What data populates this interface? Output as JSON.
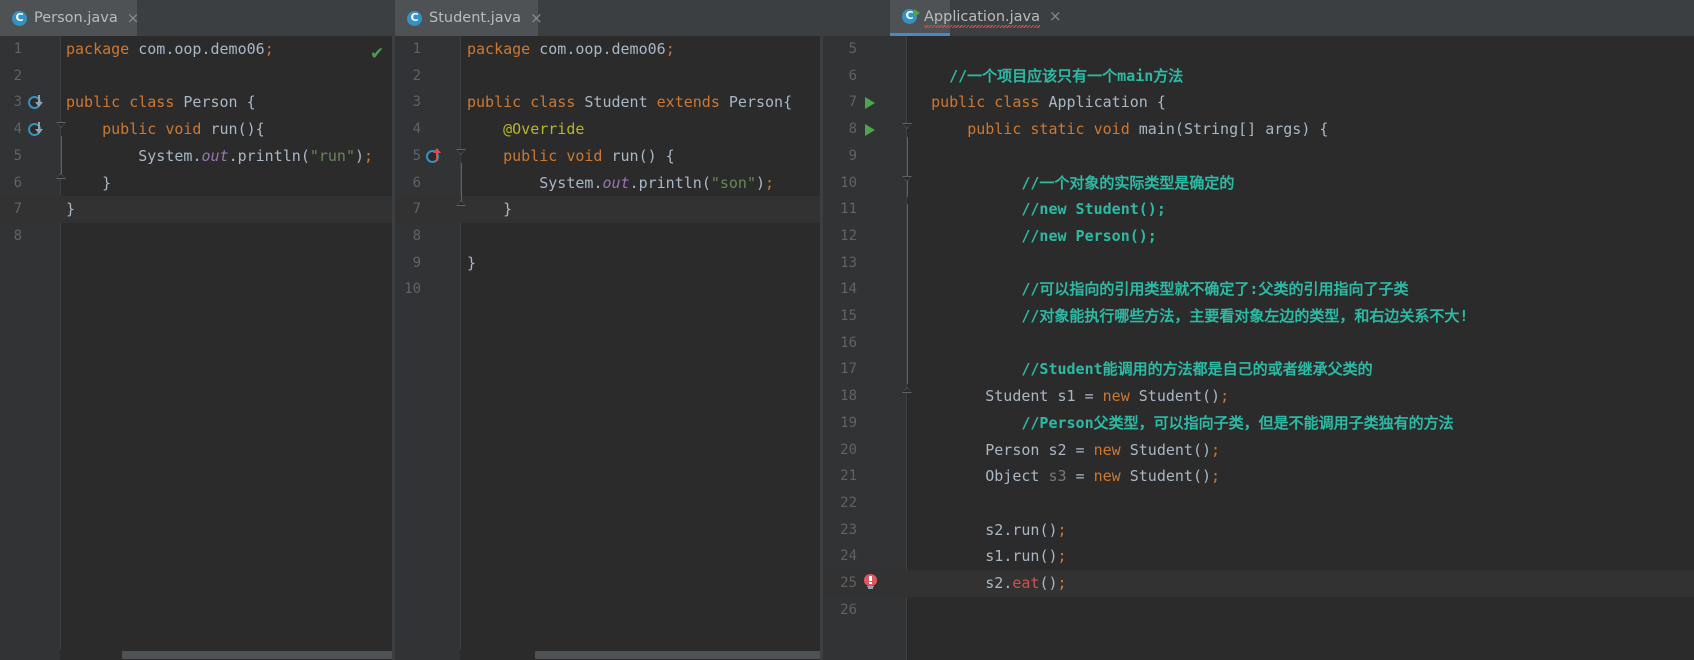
{
  "window": {
    "theme": "Darcula",
    "background": "#2b2b2b",
    "panel_background": "#3c3f41",
    "gutter_background": "#313335",
    "accent": "#4a88c7"
  },
  "tabs": [
    {
      "label": "Person.java",
      "icon": "java-class-icon",
      "close_glyph": "×",
      "state": "inactive",
      "runnable": false,
      "squiggly": false
    },
    {
      "label": "Student.java",
      "icon": "java-class-icon",
      "close_glyph": "×",
      "state": "inactive",
      "runnable": false,
      "squiggly": false
    },
    {
      "label": "Application.java",
      "icon": "java-class-runnable-icon",
      "close_glyph": "×",
      "state": "selected",
      "runnable": true,
      "squiggly": true
    }
  ],
  "panes": [
    {
      "name": "Person.java",
      "inspection_status": "ok",
      "inspection_glyph": "✔",
      "first_line": 1,
      "lines": [
        {
          "n": 1,
          "code": "package com.oop.demo06;"
        },
        {
          "n": 2,
          "code": ""
        },
        {
          "n": 3,
          "code": "public class Person {"
        },
        {
          "n": 4,
          "code": "    public void run(){"
        },
        {
          "n": 5,
          "code": "        System.out.println(\"run\");"
        },
        {
          "n": 6,
          "code": "    }"
        },
        {
          "n": 7,
          "code": "}"
        },
        {
          "n": 8,
          "code": ""
        }
      ],
      "caret_line": 7,
      "gutter_icons": [
        {
          "line": 3,
          "icon": "implemented-by-icon"
        },
        {
          "line": 4,
          "icon": "overridden-by-icon"
        }
      ]
    },
    {
      "name": "Student.java",
      "inspection_status": "ok",
      "inspection_glyph": "✔",
      "first_line": 1,
      "lines": [
        {
          "n": 1,
          "code": "package com.oop.demo06;"
        },
        {
          "n": 2,
          "code": ""
        },
        {
          "n": 3,
          "code": "public class Student extends Person{"
        },
        {
          "n": 4,
          "code": "    @Override"
        },
        {
          "n": 5,
          "code": "    public void run() {"
        },
        {
          "n": 6,
          "code": "        System.out.println(\"son\");"
        },
        {
          "n": 7,
          "code": "    }"
        },
        {
          "n": 8,
          "code": ""
        },
        {
          "n": 9,
          "code": "}"
        },
        {
          "n": 10,
          "code": ""
        }
      ],
      "caret_line": 7,
      "gutter_icons": [
        {
          "line": 5,
          "icon": "overrides-method-icon"
        }
      ]
    },
    {
      "name": "Application.java",
      "inspection_status": "error",
      "first_line": 5,
      "lines": [
        {
          "n": 5,
          "code": ""
        },
        {
          "n": 6,
          "code": "    //一个项目应该只有一个main方法"
        },
        {
          "n": 7,
          "code": "    public class Application {"
        },
        {
          "n": 8,
          "code": "        public static void main(String[] args) {"
        },
        {
          "n": 9,
          "code": ""
        },
        {
          "n": 10,
          "code": "            //一个对象的实际类型是确定的"
        },
        {
          "n": 11,
          "code": "            //new Student();"
        },
        {
          "n": 12,
          "code": "            //new Person();"
        },
        {
          "n": 13,
          "code": ""
        },
        {
          "n": 14,
          "code": "            //可以指向的引用类型就不确定了:父类的引用指向了子类"
        },
        {
          "n": 15,
          "code": "            //对象能执行哪些方法，主要看对象左边的类型，和右边关系不大!"
        },
        {
          "n": 16,
          "code": ""
        },
        {
          "n": 17,
          "code": "            //Student能调用的方法都是自己的或者继承父类的"
        },
        {
          "n": 18,
          "code": "            Student s1 = new Student();"
        },
        {
          "n": 19,
          "code": "            //Person父类型，可以指向子类，但是不能调用子类独有的方法"
        },
        {
          "n": 20,
          "code": "            Person s2 = new Student();"
        },
        {
          "n": 21,
          "code": "            Object s3 = new Student();"
        },
        {
          "n": 22,
          "code": ""
        },
        {
          "n": 23,
          "code": "            s2.run();"
        },
        {
          "n": 24,
          "code": "            s1.run();"
        },
        {
          "n": 25,
          "code": "            s2.eat();"
        },
        {
          "n": 26,
          "code": ""
        }
      ],
      "caret_line": 25,
      "gutter_icons": [
        {
          "line": 7,
          "icon": "run-class-icon"
        },
        {
          "line": 8,
          "icon": "run-method-icon"
        },
        {
          "line": 25,
          "icon": "error-bulb-icon"
        }
      ],
      "error": {
        "line": 25,
        "token": "eat",
        "color": "#d25252"
      }
    }
  ],
  "scrollbars": [
    {
      "pane": "Person.java",
      "orientation": "horizontal"
    },
    {
      "pane": "Student.java",
      "orientation": "horizontal"
    }
  ]
}
